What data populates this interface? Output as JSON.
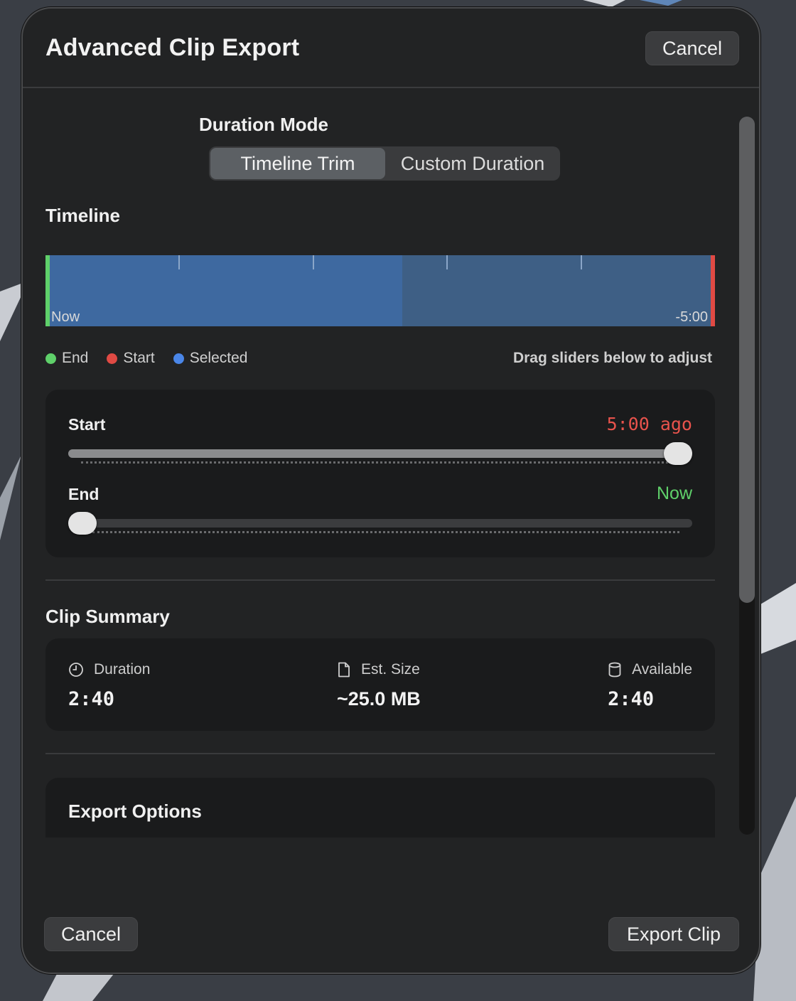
{
  "window": {
    "title": "Advanced Clip Export"
  },
  "header": {
    "cancel_label": "Cancel"
  },
  "duration_mode": {
    "label": "Duration Mode",
    "options": [
      "Timeline Trim",
      "Custom Duration"
    ],
    "selected": "Timeline Trim"
  },
  "timeline": {
    "label": "Timeline",
    "left_label": "Now",
    "right_label": "-5:00",
    "selected_fraction": 0.533,
    "legend": [
      {
        "label": "End",
        "color": "#5fd06a"
      },
      {
        "label": "Start",
        "color": "#e04a44"
      },
      {
        "label": "Selected",
        "color": "#4a86e8"
      }
    ],
    "hint": "Drag sliders below to adjust"
  },
  "sliders": {
    "start": {
      "label": "Start",
      "value": "5:00 ago",
      "color": "#e8534c",
      "position": 1.0
    },
    "end": {
      "label": "End",
      "value": "Now",
      "color": "#5fd06a",
      "position": 0.0
    }
  },
  "summary": {
    "label": "Clip Summary",
    "duration": {
      "label": "Duration",
      "value": "2:40",
      "icon": "clock-icon"
    },
    "size": {
      "label": "Est. Size",
      "value": "~25.0 MB",
      "icon": "document-icon"
    },
    "available": {
      "label": "Available",
      "value": "2:40",
      "icon": "database-icon"
    }
  },
  "export_options": {
    "label": "Export Options"
  },
  "footer": {
    "cancel_label": "Cancel",
    "export_label": "Export Clip"
  }
}
